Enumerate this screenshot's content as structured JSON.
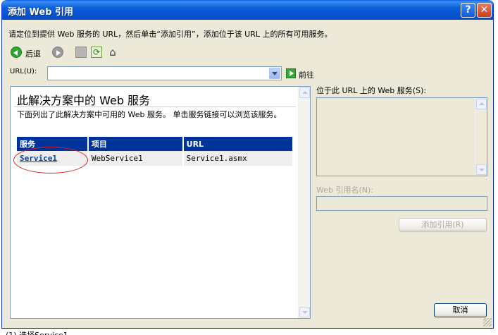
{
  "window": {
    "title": "添加 Web 引用",
    "help_glyph": "?",
    "close_glyph": "✕"
  },
  "instructions": "请定位到提供 Web 服务的 URL，然后单击“添加引用”，添加位于该 URL 上的所有可用服务。",
  "toolbar": {
    "back_label": "后退",
    "icons": [
      "back-icon",
      "forward-icon",
      "stop-icon",
      "refresh-icon",
      "home-icon"
    ]
  },
  "url_bar": {
    "label": "URL(U):",
    "value": "",
    "go_label": "前往"
  },
  "browser": {
    "heading": "此解决方案中的 Web 服务",
    "description": "下面列出了此解决方案中可用的 Web 服务。 单击服务链接可以浏览该服务。",
    "table": {
      "columns": [
        "服务",
        "项目",
        "URL"
      ],
      "rows": [
        [
          "Service1",
          "WebService1",
          "Service1.asmx"
        ]
      ]
    }
  },
  "right_panel": {
    "services_label": "位于此 URL 上的 Web 服务(S):",
    "ref_name_label": "Web 引用名(N):",
    "ref_name_value": "",
    "add_button": "添加引用(R)",
    "cancel_button": "取消"
  },
  "caption": "(1) 选择Service1",
  "colors": {
    "title_bar": "#0b5fd8",
    "table_header": "#003399",
    "highlight_circle": "#d62020",
    "dialog_bg": "#ece9d8"
  }
}
